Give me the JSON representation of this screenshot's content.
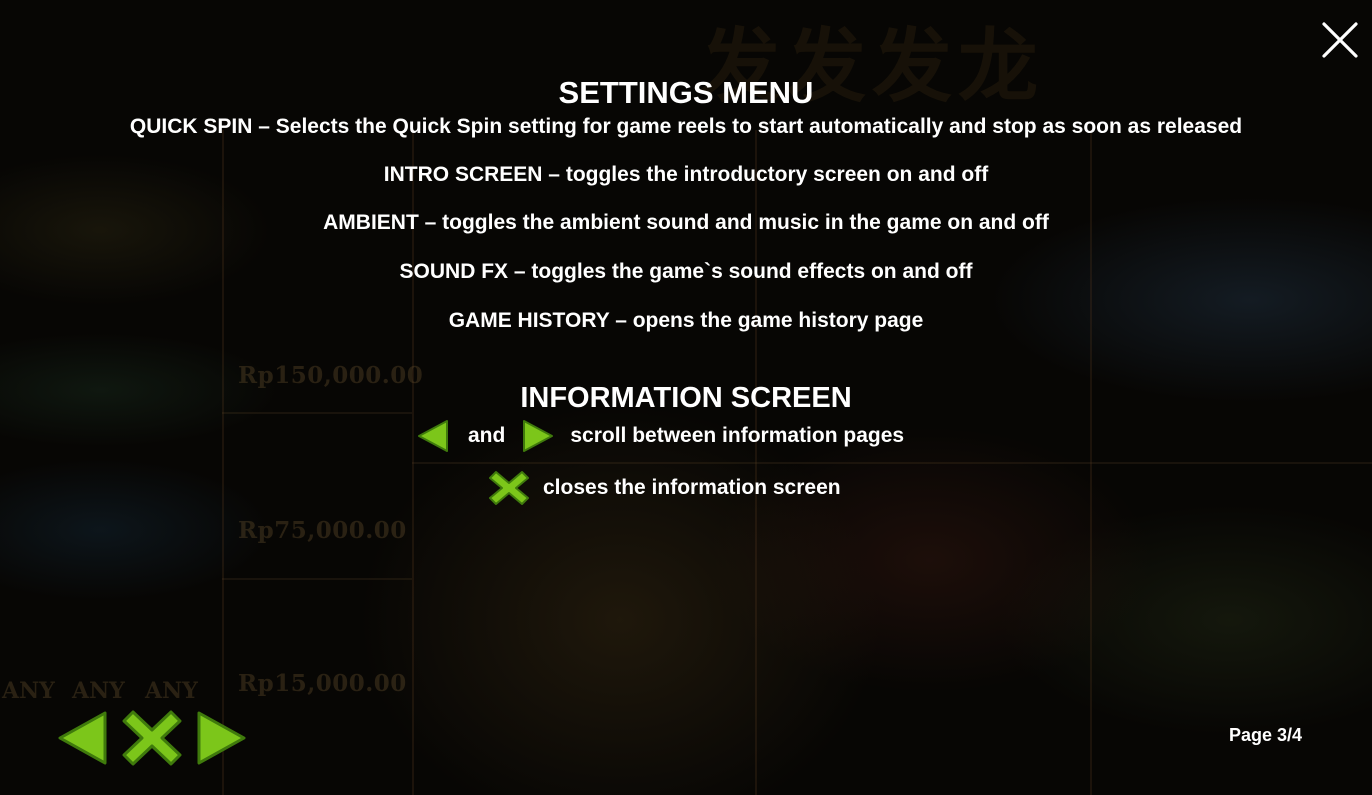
{
  "background": {
    "title_glyphs": "发发发龙",
    "prizes": [
      "Rp150,000.00",
      "Rp75,000.00",
      "Rp15,000.00"
    ],
    "any_labels": [
      "ANY",
      "ANY",
      "ANY"
    ]
  },
  "settings": {
    "heading": "SETTINGS MENU",
    "lines": [
      "QUICK SPIN – Selects the Quick Spin setting for game reels to start automatically and stop as soon as released",
      "INTRO SCREEN – toggles the introductory screen on and off",
      "AMBIENT – toggles the ambient sound and music in the game on and off",
      "SOUND FX – toggles the game`s sound effects on and off",
      "GAME HISTORY – opens the game history page"
    ]
  },
  "information": {
    "heading": "INFORMATION SCREEN",
    "and_text": "and",
    "scroll_text": "scroll between information pages",
    "close_text": "closes the information screen"
  },
  "footer": {
    "page_label": "Page 3/4"
  },
  "colors": {
    "accent_green": "#7cc61a",
    "accent_green_dark": "#3f7a0c",
    "text": "#ffffff",
    "overlay": "#050402"
  },
  "icons": {
    "close": "close-icon",
    "prev": "arrow-left-icon",
    "next": "arrow-right-icon",
    "exit": "x-icon"
  }
}
